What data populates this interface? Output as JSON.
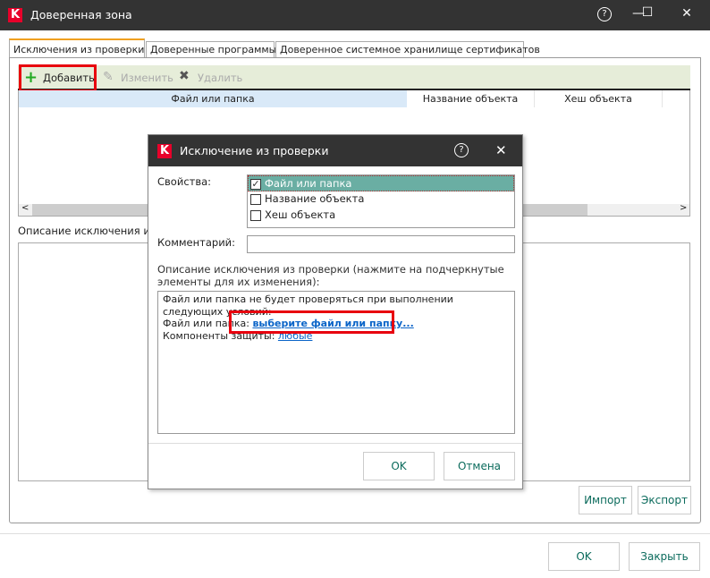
{
  "window": {
    "title": "Доверенная зона",
    "help": "?",
    "minimize": "—",
    "maximize": "☐",
    "close": "✕"
  },
  "tabs": [
    {
      "label": "Исключения из проверки",
      "active": true
    },
    {
      "label": "Доверенные программы"
    },
    {
      "label": "Доверенное системное хранилище сертификатов"
    }
  ],
  "toolbar": {
    "add": "Добавить",
    "edit": "Изменить",
    "delete": "Удалить"
  },
  "table": {
    "columns": [
      "Файл или папка",
      "Название объекта",
      "Хеш объекта"
    ],
    "scroll_left": "<",
    "scroll_right": ">"
  },
  "description_label": "Описание исключения из п",
  "buttons": {
    "import": "Импорт",
    "export": "Экспорт",
    "ok": "OK",
    "close": "Закрыть"
  },
  "dialog": {
    "title": "Исключение из проверки",
    "help": "?",
    "close": "✕",
    "properties_label": "Свойства:",
    "properties": [
      {
        "label": "Файл или папка",
        "checked": true
      },
      {
        "label": "Название объекта",
        "checked": false
      },
      {
        "label": "Хеш объекта",
        "checked": false
      }
    ],
    "comment_label": "Комментарий:",
    "comment_value": "",
    "description_label": "Описание исключения из проверки (нажмите на подчеркнутые элементы для их изменения):",
    "desc_line1": "Файл или папка не будет проверяться при выполнении следующих условий:",
    "desc_file_label": "Файл или папка: ",
    "desc_file_link": "выберите файл или папку...",
    "desc_comp_label": "Компоненты защиты: ",
    "desc_comp_link": "любые",
    "ok": "OK",
    "cancel": "Отмена"
  },
  "colors": {
    "titlebar": "#333333",
    "highlight": "#e8000e",
    "selected_row": "#6aaea3",
    "button_text": "#0b6b5c",
    "link": "#0a64c8"
  }
}
